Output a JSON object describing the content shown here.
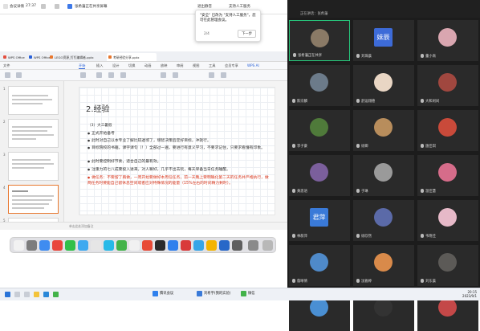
{
  "meeting": {
    "topbar_left": "会议详情",
    "timer": "27:37",
    "host_label": "张希藩正在共享屏幕",
    "audio_label": "退出静音",
    "ai_label": "支持人工服务",
    "panel_header": "正在讲话：张希藩",
    "tooltip_text": "\"安全\" 已改为 \"支持人工服务\"，您可在此管理会议。",
    "tooltip_page": "2/4",
    "tooltip_next": "下一步"
  },
  "wps": {
    "tabs": [
      "WPS Office",
      "WPS Office",
      "LEGO资源_钉钉编辑者.pptx",
      "考研经验分享.pptx"
    ],
    "menu": [
      "文件",
      "开始",
      "插入",
      "设计",
      "切换",
      "动画",
      "放映",
      "审阅",
      "视图",
      "工具",
      "会员专享",
      "WPS AI"
    ],
    "active_menu": "开始",
    "thumb_numbers": [
      "1",
      "2",
      "3",
      "4",
      "5"
    ],
    "slide": {
      "title": "2.经验",
      "subtitle": "（3）大三暑假",
      "bullets": [
        "正式开始备考",
        "此时对自己以本专业了解比较透彻了，增智决策后定好目标，冲就行。",
        "目标院校的书籍，课字课句（！）全部过一遍，要进行有意义学习，不要求记住，只要求看懂有印象。",
        "此时要控制好节奏，适合自己的最有效。",
        "注重力的七八成要投入进来，对人嘛好，几乎不出去玩，每天早备当日任务睡醒。",
        "做任务：不要留了再做，一周开始要做好本周任任务，前一天晚上要明确化第二天的任务并严格执行，做两任务时要能自己留休息空间或者应对特殊情况的能量（15%左右的时间精力剩时）。"
      ]
    },
    "status_text": "单击此处添加备注"
  },
  "participants": [
    {
      "name": "张希藩正在共享",
      "avatar": "",
      "color": "#8a7a66",
      "active": true
    },
    {
      "name": "刘珠晨",
      "avatar": "妹辰",
      "color": "#3d6bd8",
      "active": false
    },
    {
      "name": "董小商",
      "avatar": "",
      "color": "#d9a6b0",
      "active": false
    },
    {
      "name": "陈宗麟",
      "avatar": "",
      "color": "#6c7b8a",
      "active": false
    },
    {
      "name": "舒运翔德",
      "avatar": "",
      "color": "#e9d6c4",
      "active": false
    },
    {
      "name": "大和闲间",
      "avatar": "",
      "color": "#a0473f",
      "active": false
    },
    {
      "name": "李子豪",
      "avatar": "",
      "color": "#4f7a3a",
      "active": false
    },
    {
      "name": "徐卿",
      "avatar": "",
      "color": "#b88d5c",
      "active": false
    },
    {
      "name": "施佳琪",
      "avatar": "",
      "color": "#c94a3a",
      "active": false
    },
    {
      "name": "黄思语",
      "avatar": "",
      "color": "#7b5f9c",
      "active": false
    },
    {
      "name": "于琳",
      "avatar": "",
      "color": "#9a9a9a",
      "active": false
    },
    {
      "name": "温佳慧",
      "avatar": "",
      "color": "#d66c8a",
      "active": false
    },
    {
      "name": "林叙萍",
      "avatar": "君萍",
      "color": "#3a7ad8",
      "active": false
    },
    {
      "name": "徐欣然",
      "avatar": "",
      "color": "#5b6aa8",
      "active": false
    },
    {
      "name": "韦晓佳",
      "avatar": "",
      "color": "#e6b9c8",
      "active": false
    },
    {
      "name": "詹晰倩",
      "avatar": "",
      "color": "#4f8ac9",
      "active": false
    },
    {
      "name": "沈雅婷",
      "avatar": "",
      "color": "#d98a4a",
      "active": false
    },
    {
      "name": "刘东晨",
      "avatar": "",
      "color": "#5c5a57",
      "active": false
    },
    {
      "name": "",
      "avatar": "",
      "color": "#4a8fd3",
      "active": false
    },
    {
      "name": "",
      "avatar": "",
      "color": "#333333",
      "active": false
    },
    {
      "name": "",
      "avatar": "",
      "color": "#c44848",
      "active": false
    }
  ],
  "taskbar": {
    "items": [
      "腾讯会议",
      "刘希宇(我的实验)",
      "微信"
    ],
    "time": "20:15",
    "date": "2023/9/1"
  }
}
